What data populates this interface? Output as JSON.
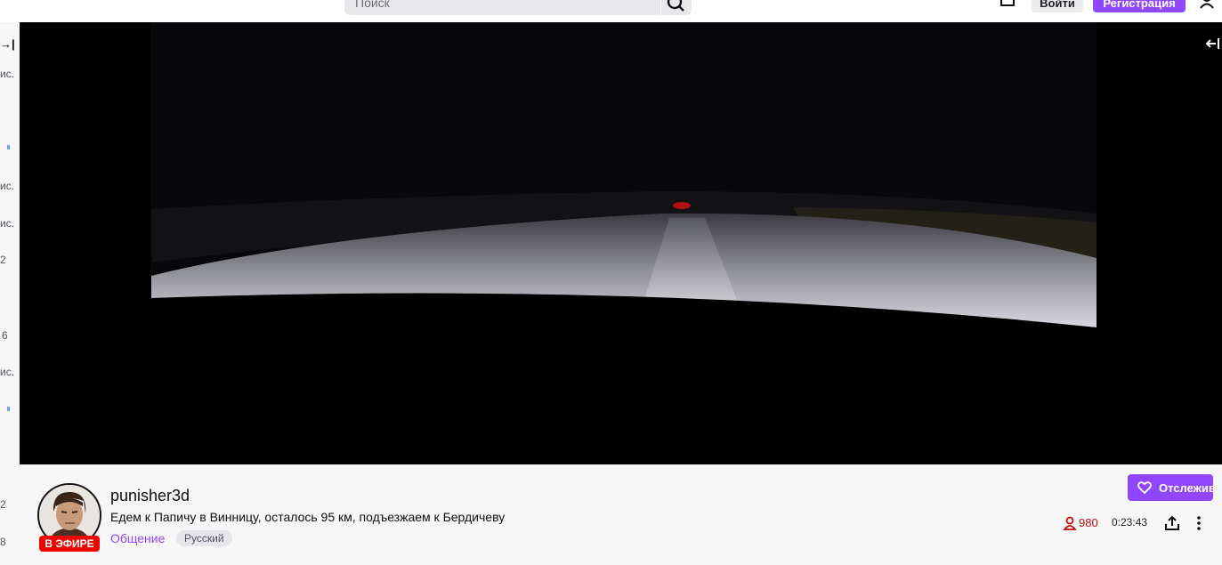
{
  "header": {
    "search_placeholder": "Поиск",
    "login_label": "Войти",
    "signup_label": "Регистрация"
  },
  "sidebar": {
    "collapse_glyph": "→|",
    "snippets": [
      "ис.",
      "ис.",
      "ис.",
      "2",
      "6",
      "ис.",
      "2",
      "8"
    ]
  },
  "stream": {
    "channel_name": "punisher3d",
    "title": "Едем к Папичу в Винницу, осталось 95 км, подъезжаем к Бердичеву",
    "category": "Общение",
    "language_tag": "Русский",
    "live_badge": "В ЭФИРЕ",
    "follow_label": "Отслеживать",
    "viewer_count": "980",
    "uptime": "0:23:43"
  },
  "colors": {
    "accent": "#9147ff",
    "live": "#eb0400",
    "viewer_count": "#c20d0d"
  },
  "icons": [
    "search-icon",
    "prime-icon",
    "user-icon",
    "collapse-icon",
    "heart-icon",
    "viewer-icon",
    "share-icon",
    "more-icon"
  ]
}
